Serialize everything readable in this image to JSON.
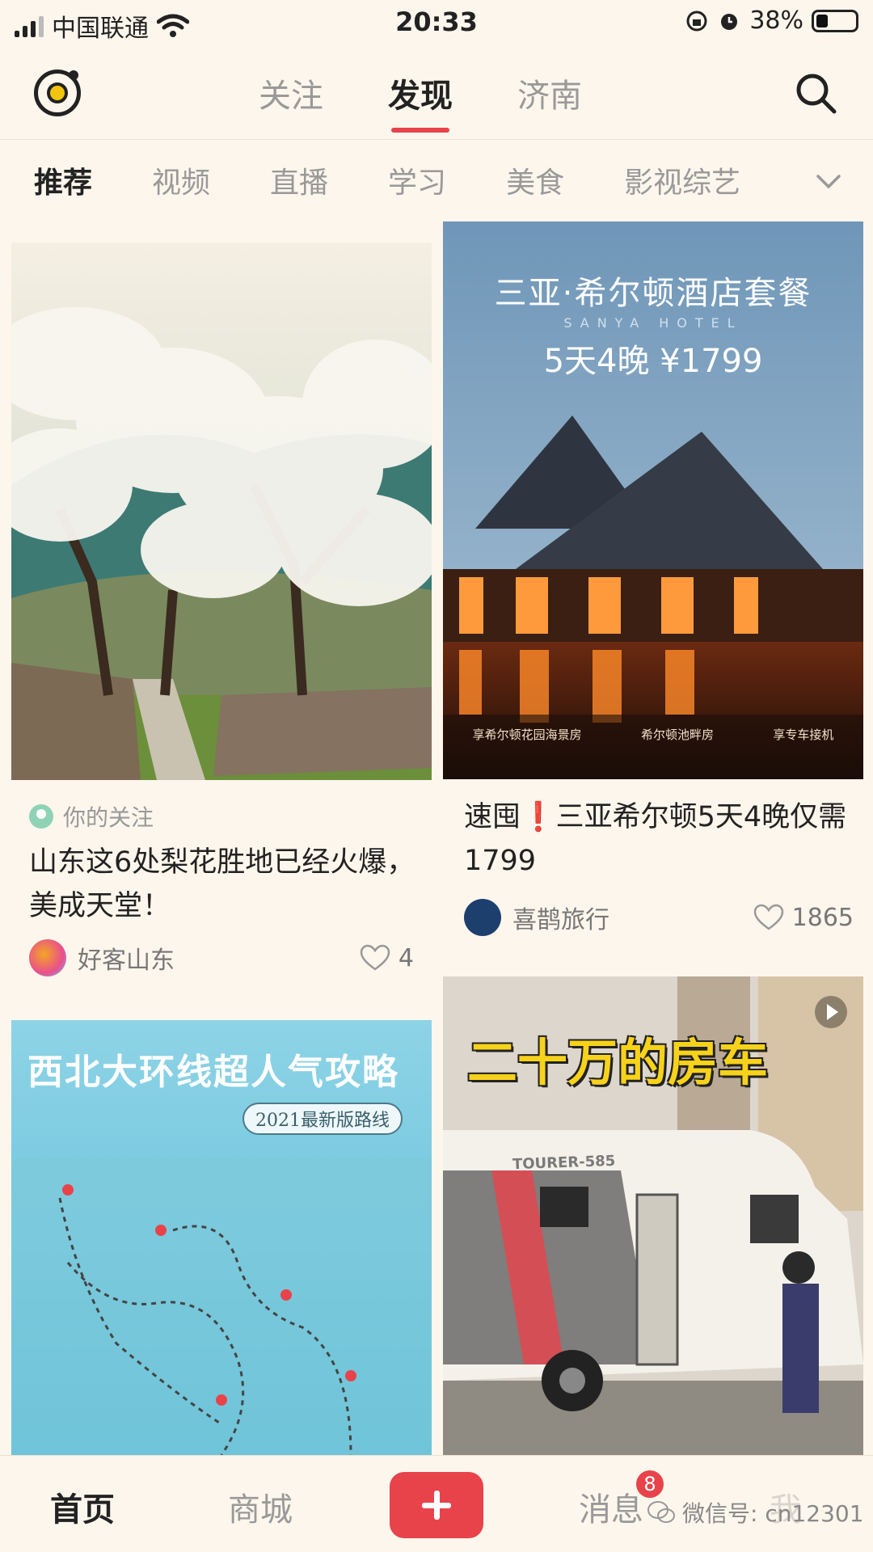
{
  "status": {
    "carrier": "中国联通",
    "time": "20:33",
    "battery": "38%"
  },
  "topnav": {
    "tabs": [
      "关注",
      "发现",
      "济南"
    ],
    "active_tab": "发现"
  },
  "categories": {
    "items": [
      "推荐",
      "视频",
      "直播",
      "学习",
      "美食",
      "影视综艺"
    ],
    "active": "推荐"
  },
  "feed": {
    "card1": {
      "tag": "你的关注",
      "title": "山东这6处梨花胜地已经火爆，美成天堂！",
      "author": "好客山东",
      "likes": "4"
    },
    "card2": {
      "image_title": "三亚·希尔顿酒店套餐",
      "image_subtitle": "SANYA HOTEL",
      "image_price": "5天4晚 ¥1799",
      "image_tags": [
        "享希尔顿花园海景房",
        "希尔顿池畔房",
        "享专车接机"
      ],
      "title": "速囤❗三亚希尔顿5天4晚仅需1799",
      "author": "喜鹊旅行",
      "likes": "1865"
    },
    "card3": {
      "image_title": "西北大环线超人气攻略",
      "image_subtitle": "2021最新版路线"
    },
    "card4": {
      "image_title": "二十万的房车",
      "rv_brand": "TOURER-585"
    }
  },
  "bottom": {
    "tabs": [
      "首页",
      "商城",
      "消息",
      "我"
    ],
    "active": "首页",
    "badge": "8",
    "watermark": "微信号: cn12301"
  },
  "colors": {
    "accent": "#e8434b",
    "background": "#fdf6ec"
  }
}
